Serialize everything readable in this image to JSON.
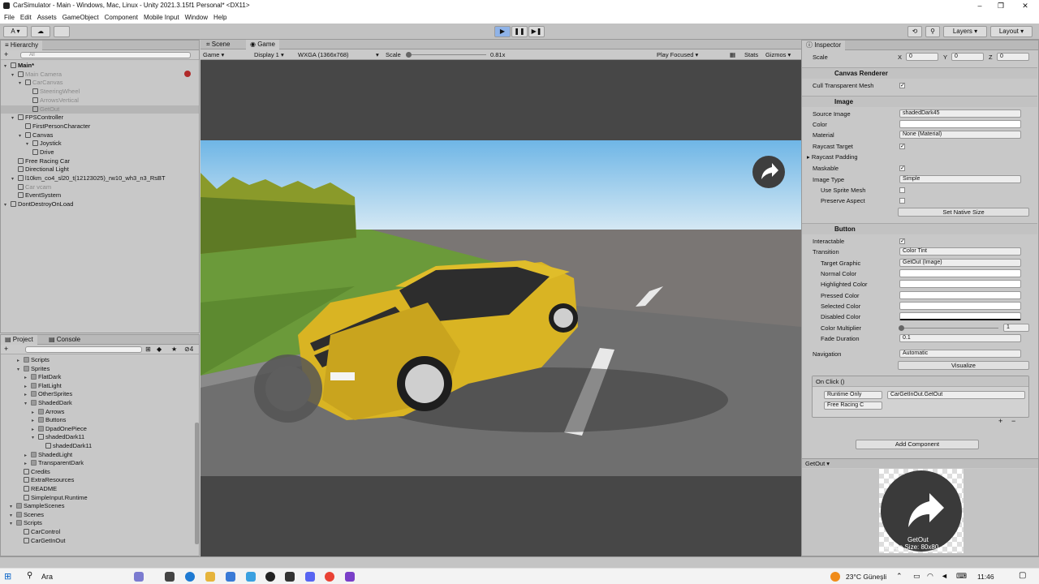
{
  "window": {
    "title": "CarSimulator - Main - Windows, Mac, Linux - Unity 2021.3.15f1 Personal* <DX11>"
  },
  "menu": [
    "File",
    "Edit",
    "Assets",
    "GameObject",
    "Component",
    "Mobile Input",
    "Window",
    "Help"
  ],
  "toolbar": {
    "account": "A",
    "layers": "Layers",
    "layout": "Layout"
  },
  "hierarchy": {
    "tab": "Hierarchy",
    "search_placeholder": "All",
    "items": [
      {
        "label": "Main*",
        "depth": 0
      },
      {
        "label": "Main Camera",
        "depth": 1
      },
      {
        "label": "CarCanvas",
        "depth": 2
      },
      {
        "label": "SteeringWheel",
        "depth": 3
      },
      {
        "label": "ArrowsVertical",
        "depth": 3
      },
      {
        "label": "GetOut",
        "depth": 3
      },
      {
        "label": "FPSController",
        "depth": 1
      },
      {
        "label": "FirstPersonCharacter",
        "depth": 2
      },
      {
        "label": "Canvas",
        "depth": 2
      },
      {
        "label": "Joystick",
        "depth": 3
      },
      {
        "label": "Drive",
        "depth": 3
      },
      {
        "label": "Free Racing Car",
        "depth": 1
      },
      {
        "label": "Directional Light",
        "depth": 1
      },
      {
        "label": "l10km_co4_sl20_t(12123025)_rw10_wh3_n3_RsBT",
        "depth": 1
      },
      {
        "label": "Car vcam",
        "depth": 1
      },
      {
        "label": "EventSystem",
        "depth": 1
      },
      {
        "label": "DontDestroyOnLoad",
        "depth": 0
      }
    ]
  },
  "project": {
    "tabs": [
      "Project",
      "Console"
    ],
    "badge": "4",
    "items": [
      {
        "label": "Scripts",
        "depth": 2
      },
      {
        "label": "Sprites",
        "depth": 2
      },
      {
        "label": "FlatDark",
        "depth": 3
      },
      {
        "label": "FlatLight",
        "depth": 3
      },
      {
        "label": "OtherSprites",
        "depth": 3
      },
      {
        "label": "ShadedDark",
        "depth": 3
      },
      {
        "label": "Arrows",
        "depth": 4
      },
      {
        "label": "Buttons",
        "depth": 4
      },
      {
        "label": "DpadOnePiece",
        "depth": 4
      },
      {
        "label": "shadedDark11",
        "depth": 4
      },
      {
        "label": "shadedDark11",
        "depth": 5
      },
      {
        "label": "ShadedLight",
        "depth": 3
      },
      {
        "label": "TransparentDark",
        "depth": 3
      },
      {
        "label": "Credits",
        "depth": 2
      },
      {
        "label": "ExtraResources",
        "depth": 2
      },
      {
        "label": "README",
        "depth": 2
      },
      {
        "label": "SimpleInput.Runtime",
        "depth": 2
      },
      {
        "label": "SampleScenes",
        "depth": 1
      },
      {
        "label": "Scenes",
        "depth": 1
      },
      {
        "label": "Scripts",
        "depth": 1
      },
      {
        "label": "CarControl",
        "depth": 2
      },
      {
        "label": "CarGetInOut",
        "depth": 2
      }
    ]
  },
  "game": {
    "tabs": [
      "Scene",
      "Game"
    ],
    "display_mode": "Game",
    "display": "Display 1",
    "resolution": "WXGA (1366x768)",
    "scale_label": "Scale",
    "scale_value": "0.81x",
    "play_focused": "Play Focused",
    "stats": "Stats",
    "gizmos": "Gizmos"
  },
  "inspector": {
    "tab": "Inspector",
    "scale": {
      "label": "Scale",
      "x": "0",
      "y": "0",
      "z": "0"
    },
    "canvas_renderer": {
      "title": "Canvas Renderer",
      "cull_label": "Cull Transparent Mesh"
    },
    "image": {
      "title": "Image",
      "source_image_label": "Source Image",
      "source_image": "shadedDark45",
      "color_label": "Color",
      "material_label": "Material",
      "material": "None (Material)",
      "raycast_target_label": "Raycast Target",
      "raycast_padding_label": "Raycast Padding",
      "maskable_label": "Maskable",
      "image_type_label": "Image Type",
      "image_type": "Simple",
      "use_sprite_mesh_label": "Use Sprite Mesh",
      "preserve_aspect_label": "Preserve Aspect",
      "set_native_size": "Set Native Size"
    },
    "button": {
      "title": "Button",
      "interactable_label": "Interactable",
      "transition_label": "Transition",
      "transition": "Color Tint",
      "target_graphic_label": "Target Graphic",
      "target_graphic": "GetOut (Image)",
      "normal_color_label": "Normal Color",
      "highlighted_color_label": "Highlighted Color",
      "pressed_color_label": "Pressed Color",
      "selected_color_label": "Selected Color",
      "disabled_color_label": "Disabled Color",
      "color_multiplier_label": "Color Multiplier",
      "color_multiplier": "1",
      "fade_duration_label": "Fade Duration",
      "fade_duration": "0.1",
      "navigation_label": "Navigation",
      "navigation": "Automatic",
      "visualize": "Visualize",
      "onclick_label": "On Click ()",
      "runtime": "Runtime Only",
      "function": "CarGetInOut.GetOut",
      "object": "Free Racing C"
    },
    "add_component": "Add Component",
    "preview": {
      "name": "GetOut",
      "caption": "GetOut",
      "size": "Image Size: 80x80"
    }
  },
  "taskbar": {
    "search": "Ara",
    "weather": "23°C  Güneşli",
    "time": "11:46"
  }
}
